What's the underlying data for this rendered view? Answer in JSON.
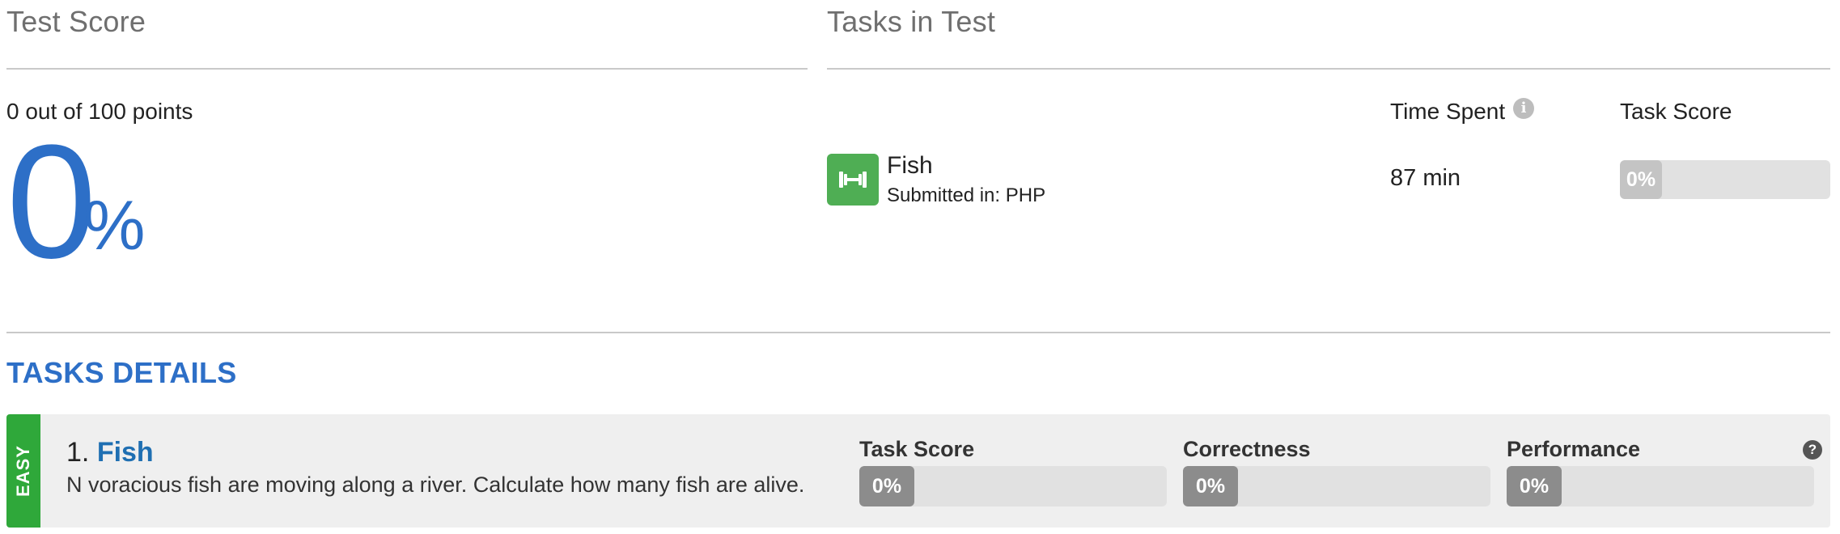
{
  "test_score": {
    "heading": "Test Score",
    "points_text": "0 out of 100 points",
    "score_value": "0",
    "score_unit": "%"
  },
  "tasks_in_test": {
    "heading": "Tasks in Test",
    "columns": {
      "time_spent": "Time Spent",
      "task_score": "Task Score"
    },
    "task": {
      "name": "Fish",
      "submitted": "Submitted in: PHP",
      "time": "87 min",
      "score_label": "0%",
      "score_fraction": 0
    }
  },
  "tasks_details": {
    "heading": "TASKS DETAILS",
    "item": {
      "difficulty": "EASY",
      "number": "1.",
      "name": "Fish",
      "description": "N voracious fish are moving along a river. Calculate how many fish are alive.",
      "metrics": [
        {
          "label": "Task Score",
          "value": "0%",
          "fraction": 0
        },
        {
          "label": "Correctness",
          "value": "0%",
          "fraction": 0
        },
        {
          "label": "Performance",
          "value": "0%",
          "fraction": 0
        }
      ]
    }
  },
  "icons": {
    "info": "info-icon",
    "help": "question-icon",
    "task": "dumbbell-icon"
  },
  "colors": {
    "accent_blue": "#2d6fc7",
    "link_blue": "#1f6fb2",
    "easy_green": "#2fa83a",
    "task_icon_green": "#4fae54",
    "bar_fill_gray": "#8c8c8c",
    "bar_fill_light": "#c4c4c4"
  }
}
